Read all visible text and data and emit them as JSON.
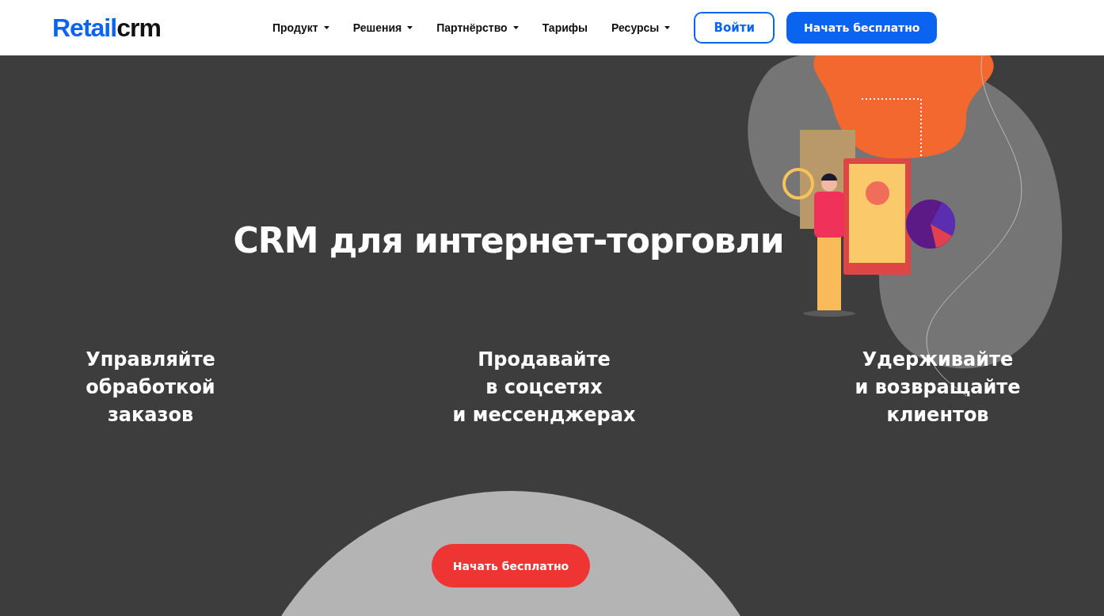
{
  "header": {
    "logo": {
      "brand_part": "Retail",
      "product_part": "crm"
    },
    "nav": [
      {
        "label": "Продукт",
        "has_menu": true
      },
      {
        "label": "Решения",
        "has_menu": true
      },
      {
        "label": "Партнёрство",
        "has_menu": true
      },
      {
        "label": "Тарифы",
        "has_menu": false
      },
      {
        "label": "Ресурсы",
        "has_menu": true
      }
    ],
    "login_button": "Войти",
    "start_button": "Начать бесплатно"
  },
  "hero": {
    "title": "CRM для интернет-торговли",
    "features": [
      {
        "lines": [
          "Управляйте",
          "обработкой",
          "заказов"
        ]
      },
      {
        "lines": [
          "Продавайте",
          "в соцсетях",
          "и мессенджерах"
        ]
      },
      {
        "lines": [
          "Удерживайте",
          "и возвращайте",
          "клиентов"
        ]
      }
    ],
    "cta_button": "Начать бесплатно"
  }
}
